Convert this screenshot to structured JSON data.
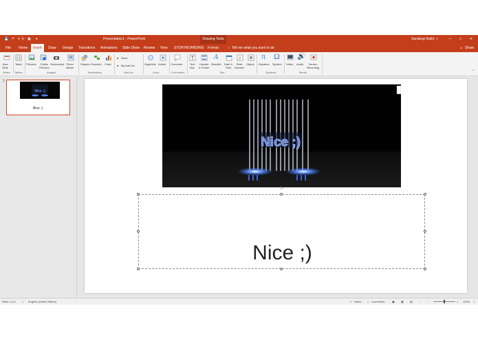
{
  "titlebar": {
    "doc_title": "Presentation1 - PowerPoint",
    "context_tools": "Drawing Tools",
    "user": "Sandeep Rathi"
  },
  "tabs": [
    "File",
    "Home",
    "Draw",
    "Insert",
    "Design",
    "Transitions",
    "Animations",
    "Slide Show",
    "Review",
    "View",
    "STORYBOARDING",
    "Format"
  ],
  "active_tab": "Insert",
  "tellme": "Tell me what you want to do",
  "share": "Share",
  "ribbon": {
    "new_slide": [
      "New",
      "Slide"
    ],
    "table": "Table",
    "pictures": "Pictures",
    "online_pictures": [
      "Online",
      "Pictures"
    ],
    "screenshot": "Screenshot",
    "photo_album": [
      "Photo",
      "Album"
    ],
    "shapes": "Shapes",
    "smartart": "SmartArt",
    "chart": "Chart",
    "store": "Store",
    "my_addins": "My Add-ins",
    "hyperlink": "Hyperlink",
    "action": "Action",
    "comment": "Comment",
    "text_box": [
      "Text",
      "Box"
    ],
    "header_footer": [
      "Header",
      "& Footer"
    ],
    "wordart": "WordArt",
    "date_time": [
      "Date &",
      "Time"
    ],
    "slide_number": [
      "Slide",
      "Number"
    ],
    "object": "Object",
    "equation": "Equation",
    "symbol": "Symbol",
    "video": "Video",
    "audio": "Audio",
    "screen_recording": [
      "Screen",
      "Recording"
    ],
    "groups": {
      "slides": "Slides",
      "tables": "Tables",
      "images": "Images",
      "illustrations": "Illustrations",
      "addins": "Add-ins",
      "links": "Links",
      "comments": "Comments",
      "text": "Text",
      "symbols": "Symbols",
      "media": "Media"
    }
  },
  "thumbnail": {
    "number": "1",
    "caption": "Nice ;)"
  },
  "slide": {
    "image_text": "Nice ;)",
    "textbox": "Nice ;)"
  },
  "status": {
    "slide": "Slide 1 of 1",
    "language": "English (United States)",
    "notes": "Notes",
    "comments": "Comments",
    "zoom": "120%"
  },
  "colors": {
    "accent": "#c43e1c",
    "ribbon_bg": "#f3f3f3",
    "pane_bg": "#e8e8e8",
    "glow": "#2f6dff"
  }
}
